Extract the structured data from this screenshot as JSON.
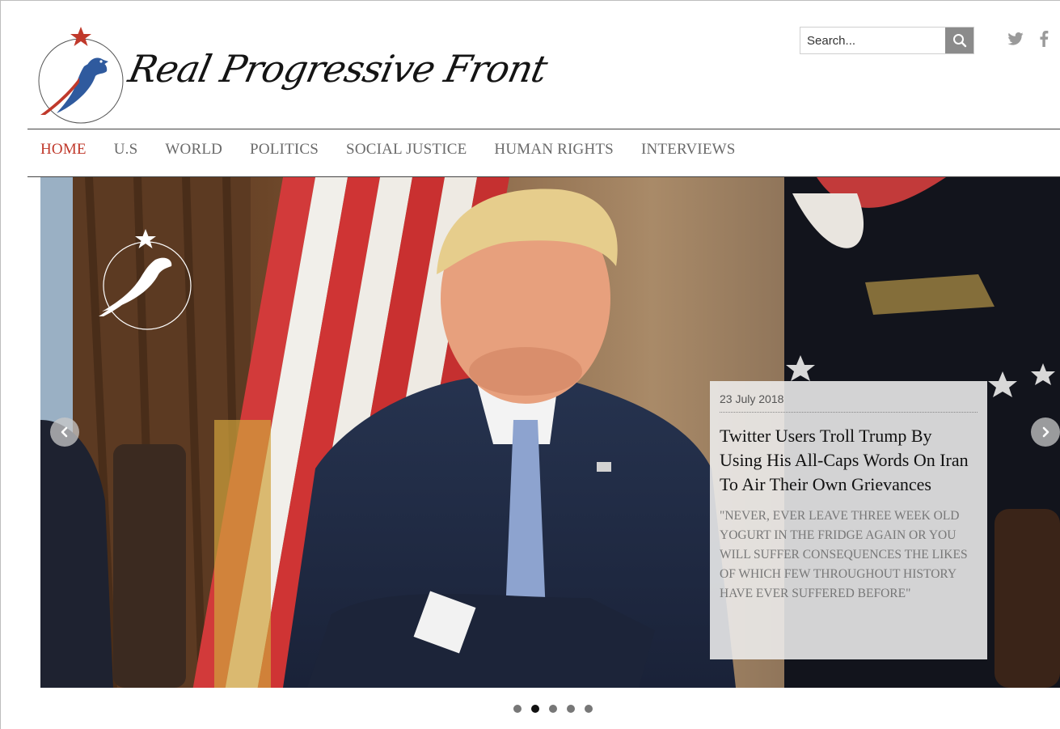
{
  "site": {
    "brand_name": "Real Progressive Front",
    "logo_tagline": "Real Progressive Front"
  },
  "search": {
    "placeholder": "Search..."
  },
  "social": {
    "icons": [
      "twitter-icon",
      "facebook-icon"
    ]
  },
  "nav": {
    "items": [
      {
        "label": "HOME",
        "active": true
      },
      {
        "label": "U.S"
      },
      {
        "label": "WORLD"
      },
      {
        "label": "POLITICS"
      },
      {
        "label": "SOCIAL JUSTICE"
      },
      {
        "label": "HUMAN RIGHTS"
      },
      {
        "label": "INTERVIEWS"
      }
    ]
  },
  "slider": {
    "active_slide": 2,
    "total_slides": 5,
    "caption": {
      "date": "23 July 2018",
      "title": "Twitter Users Troll Trump By Using His All-Caps Words On Iran To Air Their Own Grievances",
      "excerpt": "\"NEVER, EVER LEAVE THREE WEEK OLD YOGURT IN THE FRIDGE AGAIN OR YOU WILL SUFFER CONSEQUENCES THE LIKES OF WHICH FEW THROUGHOUT HISTORY HAVE EVER SUFFERED BEFORE\""
    }
  },
  "colors": {
    "nav_active": "#c0392b",
    "nav_default": "#6a6a6a",
    "search_button": "#8b8b8b"
  }
}
